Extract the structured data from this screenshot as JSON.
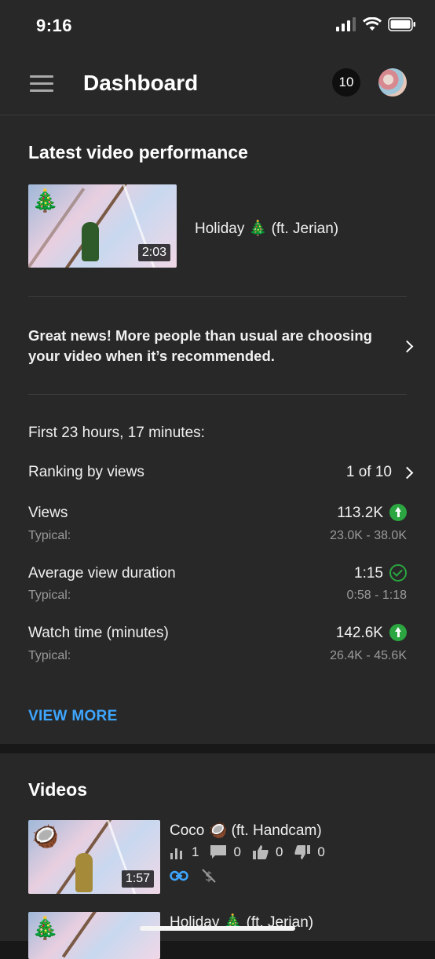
{
  "status_bar": {
    "time": "9:16"
  },
  "app_bar": {
    "title": "Dashboard",
    "notifications_count": "10"
  },
  "latest": {
    "heading": "Latest video performance",
    "video_title": "Holiday 🎄 (ft. Jerian)",
    "duration": "2:03",
    "insight": "Great news! More people than usual are choosing your video when it’s recommended.",
    "period": "First 23 hours, 17 minutes:",
    "ranking_label": "Ranking by views",
    "ranking_value": "1 of 10",
    "metrics": [
      {
        "label": "Views",
        "value": "113.2K",
        "typical_label": "Typical:",
        "typical": "23.0K - 38.0K",
        "status": "up"
      },
      {
        "label": "Average view duration",
        "value": "1:15",
        "typical_label": "Typical:",
        "typical": "0:58 - 1:18",
        "status": "check"
      },
      {
        "label": "Watch time (minutes)",
        "value": "142.6K",
        "typical_label": "Typical:",
        "typical": "26.4K - 45.6K",
        "status": "up"
      }
    ],
    "view_more": "VIEW MORE"
  },
  "videos": {
    "heading": "Videos",
    "items": [
      {
        "title": "Coco 🥥 (ft. Handcam)",
        "duration": "1:57",
        "views": "1",
        "comments": "0",
        "likes": "0",
        "dislikes": "0"
      },
      {
        "title": "Holiday 🎄 (ft. Jerian)"
      }
    ]
  },
  "colors": {
    "accent_blue": "#3ea6ff",
    "positive_green": "#2ba640",
    "background": "#282828"
  }
}
